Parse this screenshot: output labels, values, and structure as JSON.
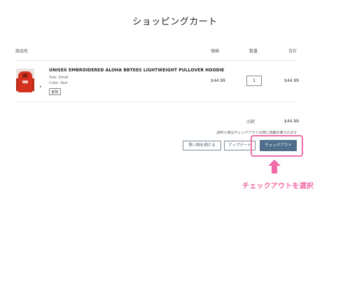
{
  "page_title": "ショッピングカート",
  "table": {
    "headers": {
      "product": "商品名",
      "price": "価格",
      "quantity": "数量",
      "total": "合計"
    }
  },
  "item": {
    "name": "UNISEX EMBROIDERED ALOHA BBTEES LIGHTWEIGHT PULLOVER HOODIE",
    "size": "Size: Small",
    "color": "Color: Red",
    "remove_label": "削除",
    "price": "$44.99",
    "quantity": "1",
    "total": "$44.99",
    "bullet": "•"
  },
  "summary": {
    "subtotal_label": "小計",
    "subtotal_value": "$44.99",
    "note": "送料と税はチェックアウトの際に自動計算されます"
  },
  "buttons": {
    "continue_shopping": "買い物を続ける",
    "update": "アップデート",
    "checkout": "チェックアウト"
  },
  "annotation": {
    "label": "チェックアウトを選択",
    "color": "#f06ca8"
  },
  "colors": {
    "checkout_button": "#4f6f8c",
    "product_red": "#d4321f"
  }
}
